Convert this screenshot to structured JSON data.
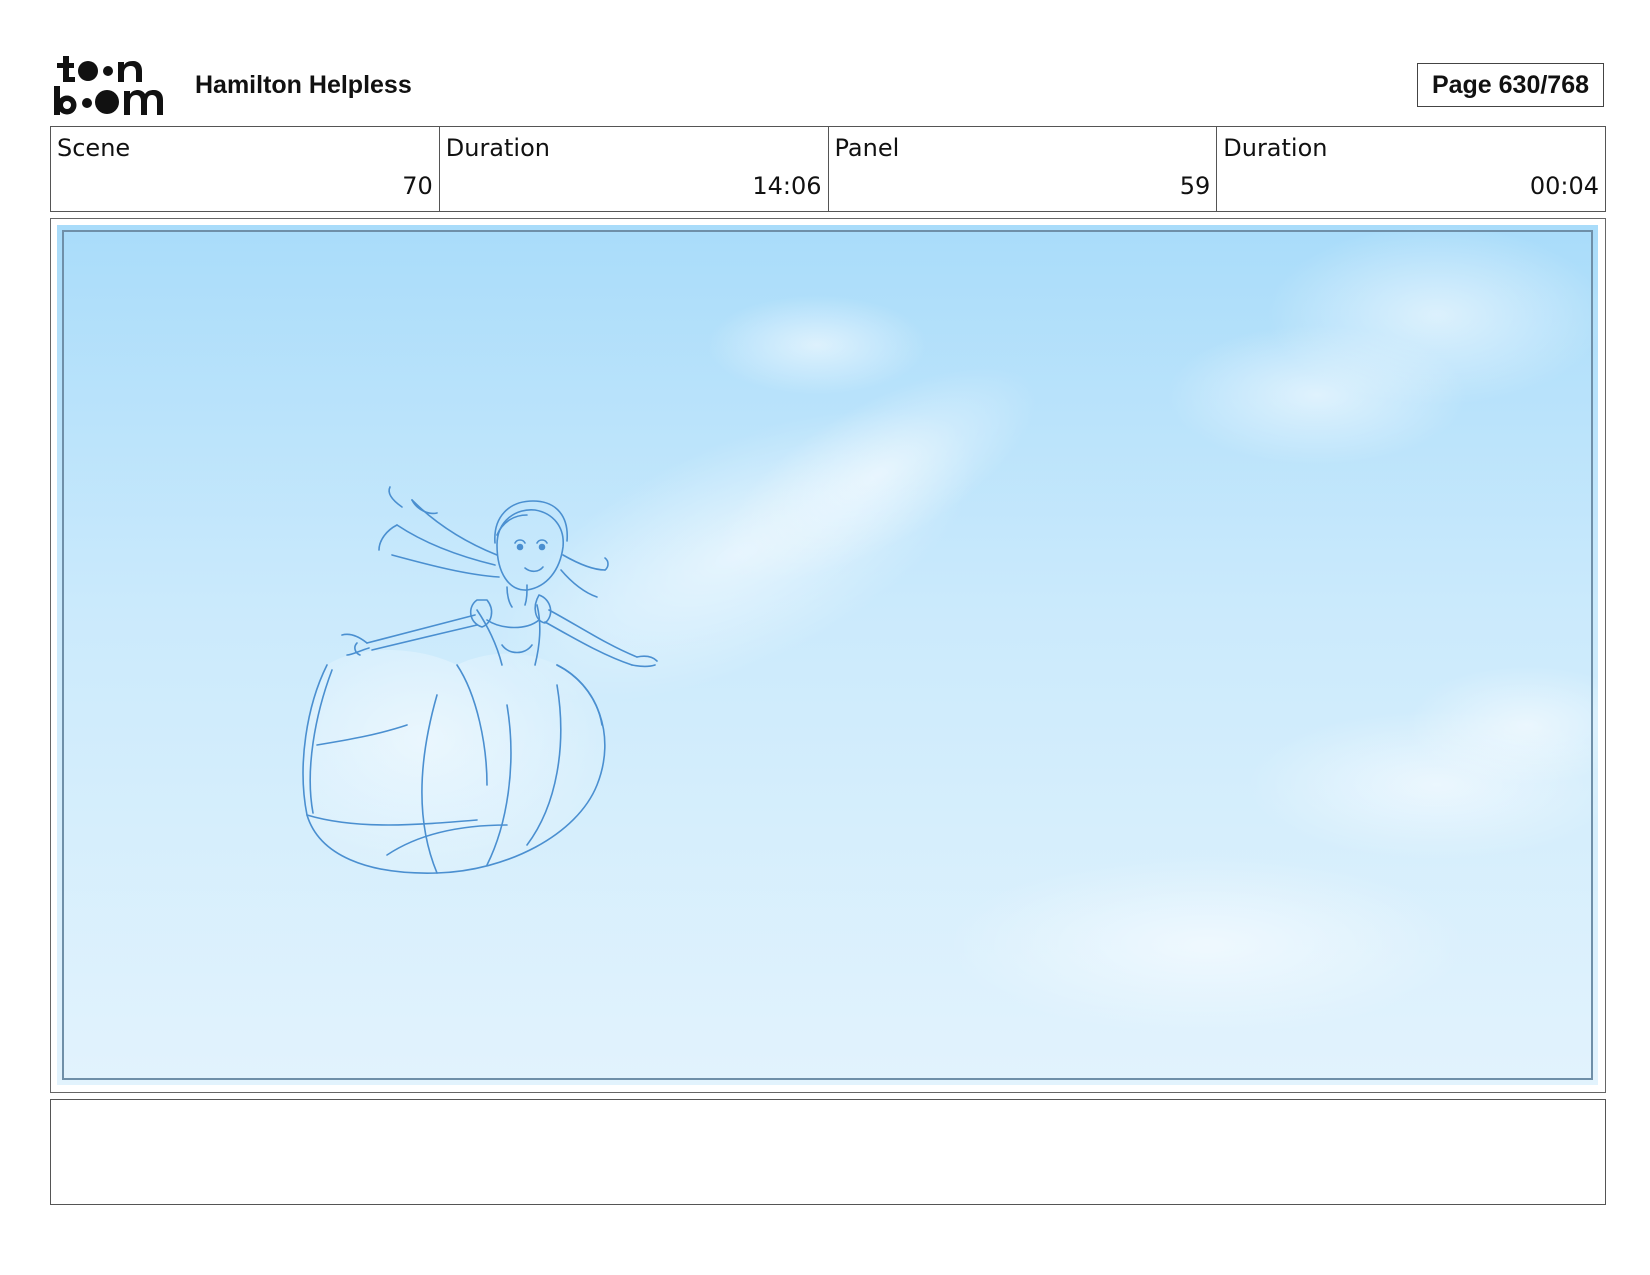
{
  "header": {
    "logo_icon": "toonboom-logo-icon",
    "project_title": "Hamilton Helpless",
    "page_label": "Page 630/768"
  },
  "info": {
    "scene_label": "Scene",
    "scene_value": "70",
    "scene_duration_label": "Duration",
    "scene_duration_value": "14:06",
    "panel_label": "Panel",
    "panel_value": "59",
    "panel_duration_label": "Duration",
    "panel_duration_value": "00:04"
  },
  "panel": {
    "sky_top_color": "#a9dcfa",
    "sky_bottom_color": "#e2f3fd",
    "sketch_color": "#4a8fd0",
    "frame_border_color": "#6f8fa8"
  },
  "notes": {}
}
